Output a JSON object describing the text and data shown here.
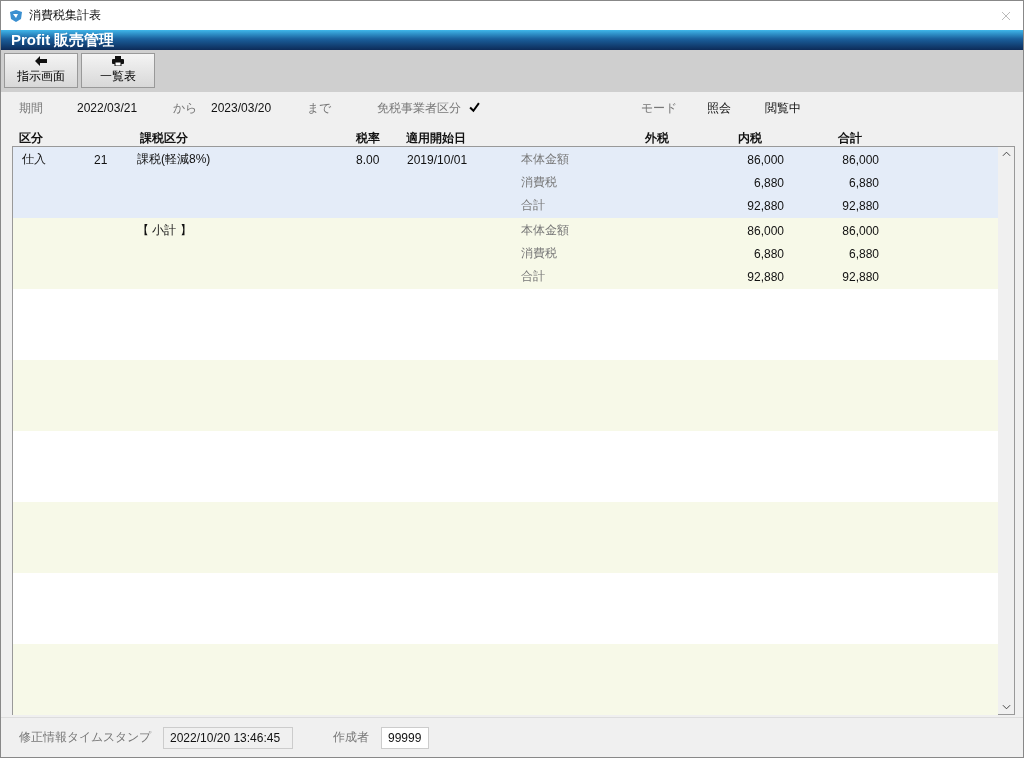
{
  "window": {
    "title": "消費税集計表"
  },
  "app_header": {
    "title": "Profit 販売管理"
  },
  "toolbar": [
    {
      "label": "指示画面",
      "kind": "back"
    },
    {
      "label": "一覧表",
      "kind": "print"
    }
  ],
  "filters": {
    "period_label": "期間",
    "from_date": "2022/03/21",
    "from_label": "から",
    "to_date": "2023/03/20",
    "to_label": "まで",
    "exempt_label": "免税事業者区分",
    "exempt_checked": true,
    "mode_label": "モード",
    "mode_value": "照会",
    "status": "閲覧中"
  },
  "table": {
    "columns": [
      "区分",
      "課税区分",
      "税率",
      "適用開始日",
      "外税",
      "内税",
      "合計"
    ],
    "groups": [
      {
        "kubun": "仕入",
        "code": "21",
        "category": "課税(軽減8%)",
        "rate": "8.00",
        "start_date": "2019/10/01",
        "selected": true,
        "lines": [
          {
            "label": "本体金額",
            "inner_tax": "86,000",
            "total": "86,000"
          },
          {
            "label": "消費税",
            "inner_tax": "6,880",
            "total": "6,880"
          },
          {
            "label": "合計",
            "inner_tax": "92,880",
            "total": "92,880"
          }
        ]
      },
      {
        "category": "【 小計 】",
        "selected": false,
        "lines": [
          {
            "label": "本体金額",
            "inner_tax": "86,000",
            "total": "86,000"
          },
          {
            "label": "消費税",
            "inner_tax": "6,880",
            "total": "6,880"
          },
          {
            "label": "合計",
            "inner_tax": "92,880",
            "total": "92,880"
          }
        ]
      }
    ]
  },
  "footer": {
    "timestamp_label": "修正情報タイムスタンプ",
    "timestamp": "2022/10/20 13:46:45",
    "author_label": "作成者",
    "author": "99999"
  }
}
